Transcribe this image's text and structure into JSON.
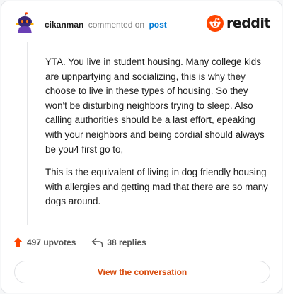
{
  "comment": {
    "username": "cikanman",
    "verb": "commented on",
    "target": "post",
    "paragraphs": [
      "YTA. You live in student housing. Many college kids are upnpartying and socializing, this is why they choose to live in these types of housing. So they won't be disturbing neighbors trying to sleep. Also calling authorities should be a last effort, epeaking with your neighbors and being cordial should always be you4 first go to,",
      "This is the equivalent of living in dog friendly housing with allergies and getting mad that there are so many dogs around."
    ]
  },
  "brand": {
    "name": "reddit",
    "color": "#ff4500"
  },
  "stats": {
    "upvotes": "497 upvotes",
    "replies": "38 replies"
  },
  "cta": {
    "label": "View the conversation"
  },
  "icons": {
    "logo": "reddit-alien-icon",
    "upvote": "upvote-arrow-icon",
    "reply": "reply-arrow-icon",
    "avatar": "snoo-avatar-icon"
  },
  "colors": {
    "upvote": "#ff4500",
    "link": "#0079d3",
    "cta_text": "#d74a0b"
  }
}
